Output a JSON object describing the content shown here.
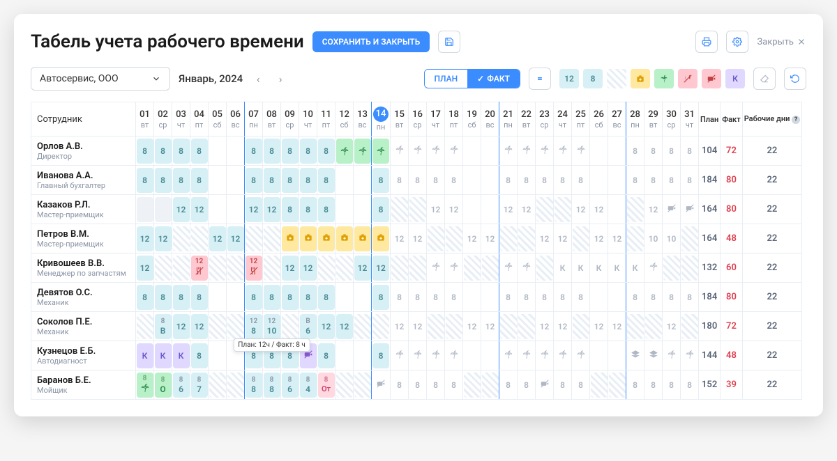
{
  "header": {
    "title": "Табель учета рабочего времени",
    "save_close": "СОХРАНИТЬ И ЗАКРЫТЬ",
    "close": "Закрыть"
  },
  "filter": {
    "company": "Автосервис, ООО",
    "month": "Январь, 2024",
    "plan": "ПЛАН",
    "fact": "ФАКТ"
  },
  "legend": {
    "h12": "12",
    "h8": "8",
    "k": "К"
  },
  "days": [
    {
      "n": "01",
      "d": "вт"
    },
    {
      "n": "02",
      "d": "ср"
    },
    {
      "n": "03",
      "d": "чт"
    },
    {
      "n": "04",
      "d": "пт"
    },
    {
      "n": "05",
      "d": "сб"
    },
    {
      "n": "06",
      "d": "вс"
    },
    {
      "n": "07",
      "d": "пн"
    },
    {
      "n": "08",
      "d": "вт"
    },
    {
      "n": "09",
      "d": "ср"
    },
    {
      "n": "10",
      "d": "чт"
    },
    {
      "n": "11",
      "d": "пт"
    },
    {
      "n": "12",
      "d": "сб"
    },
    {
      "n": "13",
      "d": "вс"
    },
    {
      "n": "14",
      "d": "пн",
      "today": true
    },
    {
      "n": "15",
      "d": "вт"
    },
    {
      "n": "16",
      "d": "ср"
    },
    {
      "n": "17",
      "d": "чт"
    },
    {
      "n": "18",
      "d": "пт"
    },
    {
      "n": "19",
      "d": "сб"
    },
    {
      "n": "20",
      "d": "вс"
    },
    {
      "n": "21",
      "d": "пн"
    },
    {
      "n": "22",
      "d": "вт"
    },
    {
      "n": "23",
      "d": "ср"
    },
    {
      "n": "24",
      "d": "чт"
    },
    {
      "n": "25",
      "d": "пт"
    },
    {
      "n": "26",
      "d": "сб"
    },
    {
      "n": "27",
      "d": "вс"
    },
    {
      "n": "28",
      "d": "пн"
    },
    {
      "n": "29",
      "d": "вт"
    },
    {
      "n": "30",
      "d": "ср"
    },
    {
      "n": "31",
      "d": "чт"
    }
  ],
  "cols": {
    "emp": "Сотрудник",
    "plan": "План",
    "fact": "Факт",
    "wd": "Рабочие дни"
  },
  "tooltip": "План: 12ч / Факт: 8 ч",
  "rows": [
    {
      "name": "Орлов А.В.",
      "role": "Директор",
      "cells": [
        "8",
        "8",
        "8",
        "8",
        "",
        "",
        "8",
        "8",
        "8",
        "8",
        "8",
        "vac",
        "vac",
        "vac",
        "pf",
        "pf",
        "pf",
        "pf",
        "",
        "",
        "pf",
        "pf",
        "pf",
        "pf",
        "pf",
        "",
        "",
        "8f",
        "8f",
        "8f",
        "8f"
      ],
      "plan": "104",
      "fact": "72",
      "wd": "22"
    },
    {
      "name": "Иванова А.А.",
      "role": "Главный бухгалтер",
      "cells": [
        "8",
        "8",
        "8",
        "8",
        "",
        "",
        "8",
        "8",
        "8",
        "8",
        "8",
        "",
        "",
        "8",
        "8f",
        "8f",
        "8f",
        "8f",
        "",
        "",
        "8f",
        "8f",
        "8f",
        "8f",
        "8f",
        "",
        "",
        "8f",
        "8f",
        "8f",
        "8f"
      ],
      "plan": "184",
      "fact": "80",
      "wd": "22"
    },
    {
      "name": "Казаков Р.Л.",
      "role": "Мастер-приемщик",
      "cells": [
        "g",
        "g",
        "12",
        "12",
        "",
        "",
        "12",
        "12",
        "8",
        "8",
        "8",
        "",
        "",
        "8",
        "h",
        "h",
        "12f",
        "12f",
        "",
        "",
        "12f",
        "12f",
        "h",
        "h",
        "12f",
        "12f",
        "",
        "h",
        "12f",
        "nf",
        "nf"
      ],
      "plan": "164",
      "fact": "80",
      "wd": "22"
    },
    {
      "name": "Петров В.М.",
      "role": "Мастер-приемщик",
      "cells": [
        "12",
        "12",
        "h",
        "h",
        "12",
        "12",
        "h",
        "h",
        "s",
        "s",
        "s",
        "s",
        "s",
        "s",
        "12f",
        "12f",
        "h",
        "h",
        "12f",
        "12f",
        "h",
        "h",
        "12f",
        "12f",
        "h",
        "12f",
        "12f",
        "h",
        "10f",
        "10f",
        "h"
      ],
      "plan": "164",
      "fact": "48",
      "wd": "22"
    },
    {
      "name": "Кривошеев В.В.",
      "role": "Менеджер по запчастям",
      "cells": [
        "12",
        "h",
        "h",
        "t12",
        "h",
        "h",
        "t12",
        "h",
        "12",
        "12",
        "h",
        "h",
        "12",
        "12",
        "h",
        "h",
        "pf",
        "pf",
        "h",
        "h",
        "pf",
        "pf",
        "h",
        "Kf",
        "Kf",
        "Kf",
        "Kf",
        "Kf",
        "pf",
        "h",
        "h"
      ],
      "plan": "132",
      "fact": "60",
      "wd": "22"
    },
    {
      "name": "Девятов О.С.",
      "role": "Механик",
      "cells": [
        "8",
        "8",
        "8",
        "8",
        "",
        "",
        "8",
        "8",
        "8",
        "8",
        "8",
        "",
        "",
        "8",
        "8f",
        "8f",
        "8f",
        "8f",
        "",
        "",
        "8f",
        "8f",
        "8f",
        "8f",
        "8f",
        "",
        "",
        "8f",
        "8f",
        "8f",
        "8f"
      ],
      "plan": "184",
      "fact": "80",
      "wd": "22"
    },
    {
      "name": "Соколов П.Е.",
      "role": "Механик",
      "cells": [
        "h",
        "8B",
        "12",
        "12",
        "h",
        "h",
        "12_8",
        "12_10",
        "h",
        "B_6",
        "12",
        "12",
        "h",
        "h",
        "12f",
        "12f",
        "h",
        "h",
        "12f",
        "12f",
        "h",
        "h",
        "12f",
        "12f",
        "h",
        "12f",
        "12f",
        "h",
        "h",
        "12f",
        "h"
      ],
      "plan": "180",
      "fact": "72",
      "wd": "22"
    },
    {
      "name": "Кузнецов Е.Б.",
      "role": "Автодиагност",
      "cells": [
        "K",
        "K",
        "K",
        "8",
        "",
        "",
        "8",
        "8tt",
        "8",
        "n",
        "8",
        "",
        "",
        "8",
        "pf",
        "pf",
        "pf",
        "pf",
        "",
        "",
        "pf",
        "pf",
        "pf",
        "pf",
        "pf",
        "",
        "",
        "grad",
        "grad",
        "pf",
        "pf"
      ],
      "plan": "144",
      "fact": "48",
      "wd": "22"
    },
    {
      "name": "Баранов Б.Е.",
      "role": "Мойщик",
      "cells": [
        "8palm",
        "8O",
        "86",
        "87",
        "h",
        "h",
        "8f0",
        "8f0",
        "86b",
        "84",
        "8ot",
        "h",
        "h",
        "nlf",
        "8f",
        "8f",
        "8f",
        "8f",
        "h",
        "h",
        "8f",
        "8f",
        "nf",
        "8f",
        "8f",
        "h",
        "h",
        "8f",
        "8f",
        "8f",
        "8f"
      ],
      "plan": "152",
      "fact": "39",
      "wd": "22"
    }
  ]
}
